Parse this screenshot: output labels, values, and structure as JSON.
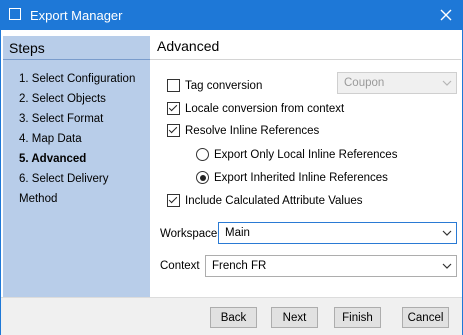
{
  "window": {
    "title": "Export Manager"
  },
  "steps": {
    "title": "Steps",
    "items": [
      {
        "label": "1. Select Configuration",
        "active": false
      },
      {
        "label": "2. Select Objects",
        "active": false
      },
      {
        "label": "3. Select Format",
        "active": false
      },
      {
        "label": "4. Map Data",
        "active": false
      },
      {
        "label": "5. Advanced",
        "active": true
      },
      {
        "label": "6. Select Delivery Method",
        "active": false
      }
    ]
  },
  "advanced": {
    "title": "Advanced",
    "tag_conversion": {
      "label": "Tag conversion",
      "checked": false,
      "combo_value": "Coupon",
      "combo_enabled": false
    },
    "locale_conversion": {
      "label": "Locale conversion from context",
      "checked": true
    },
    "resolve_inline": {
      "label": "Resolve Inline References",
      "checked": true
    },
    "export_local": {
      "label": "Export Only Local Inline References",
      "selected": false
    },
    "export_inherited": {
      "label": "Export Inherited Inline References",
      "selected": true
    },
    "include_calculated": {
      "label": "Include Calculated Attribute Values",
      "checked": true
    },
    "workspace": {
      "label": "Workspace",
      "value": "Main"
    },
    "context": {
      "label": "Context",
      "value": "French FR"
    }
  },
  "buttons": {
    "back": "Back",
    "next": "Next",
    "finish": "Finish",
    "cancel": "Cancel"
  },
  "colors": {
    "titlebar": "#1e78d7",
    "sidebar": "#b8cde9",
    "focus_border": "#2a7ad4"
  }
}
